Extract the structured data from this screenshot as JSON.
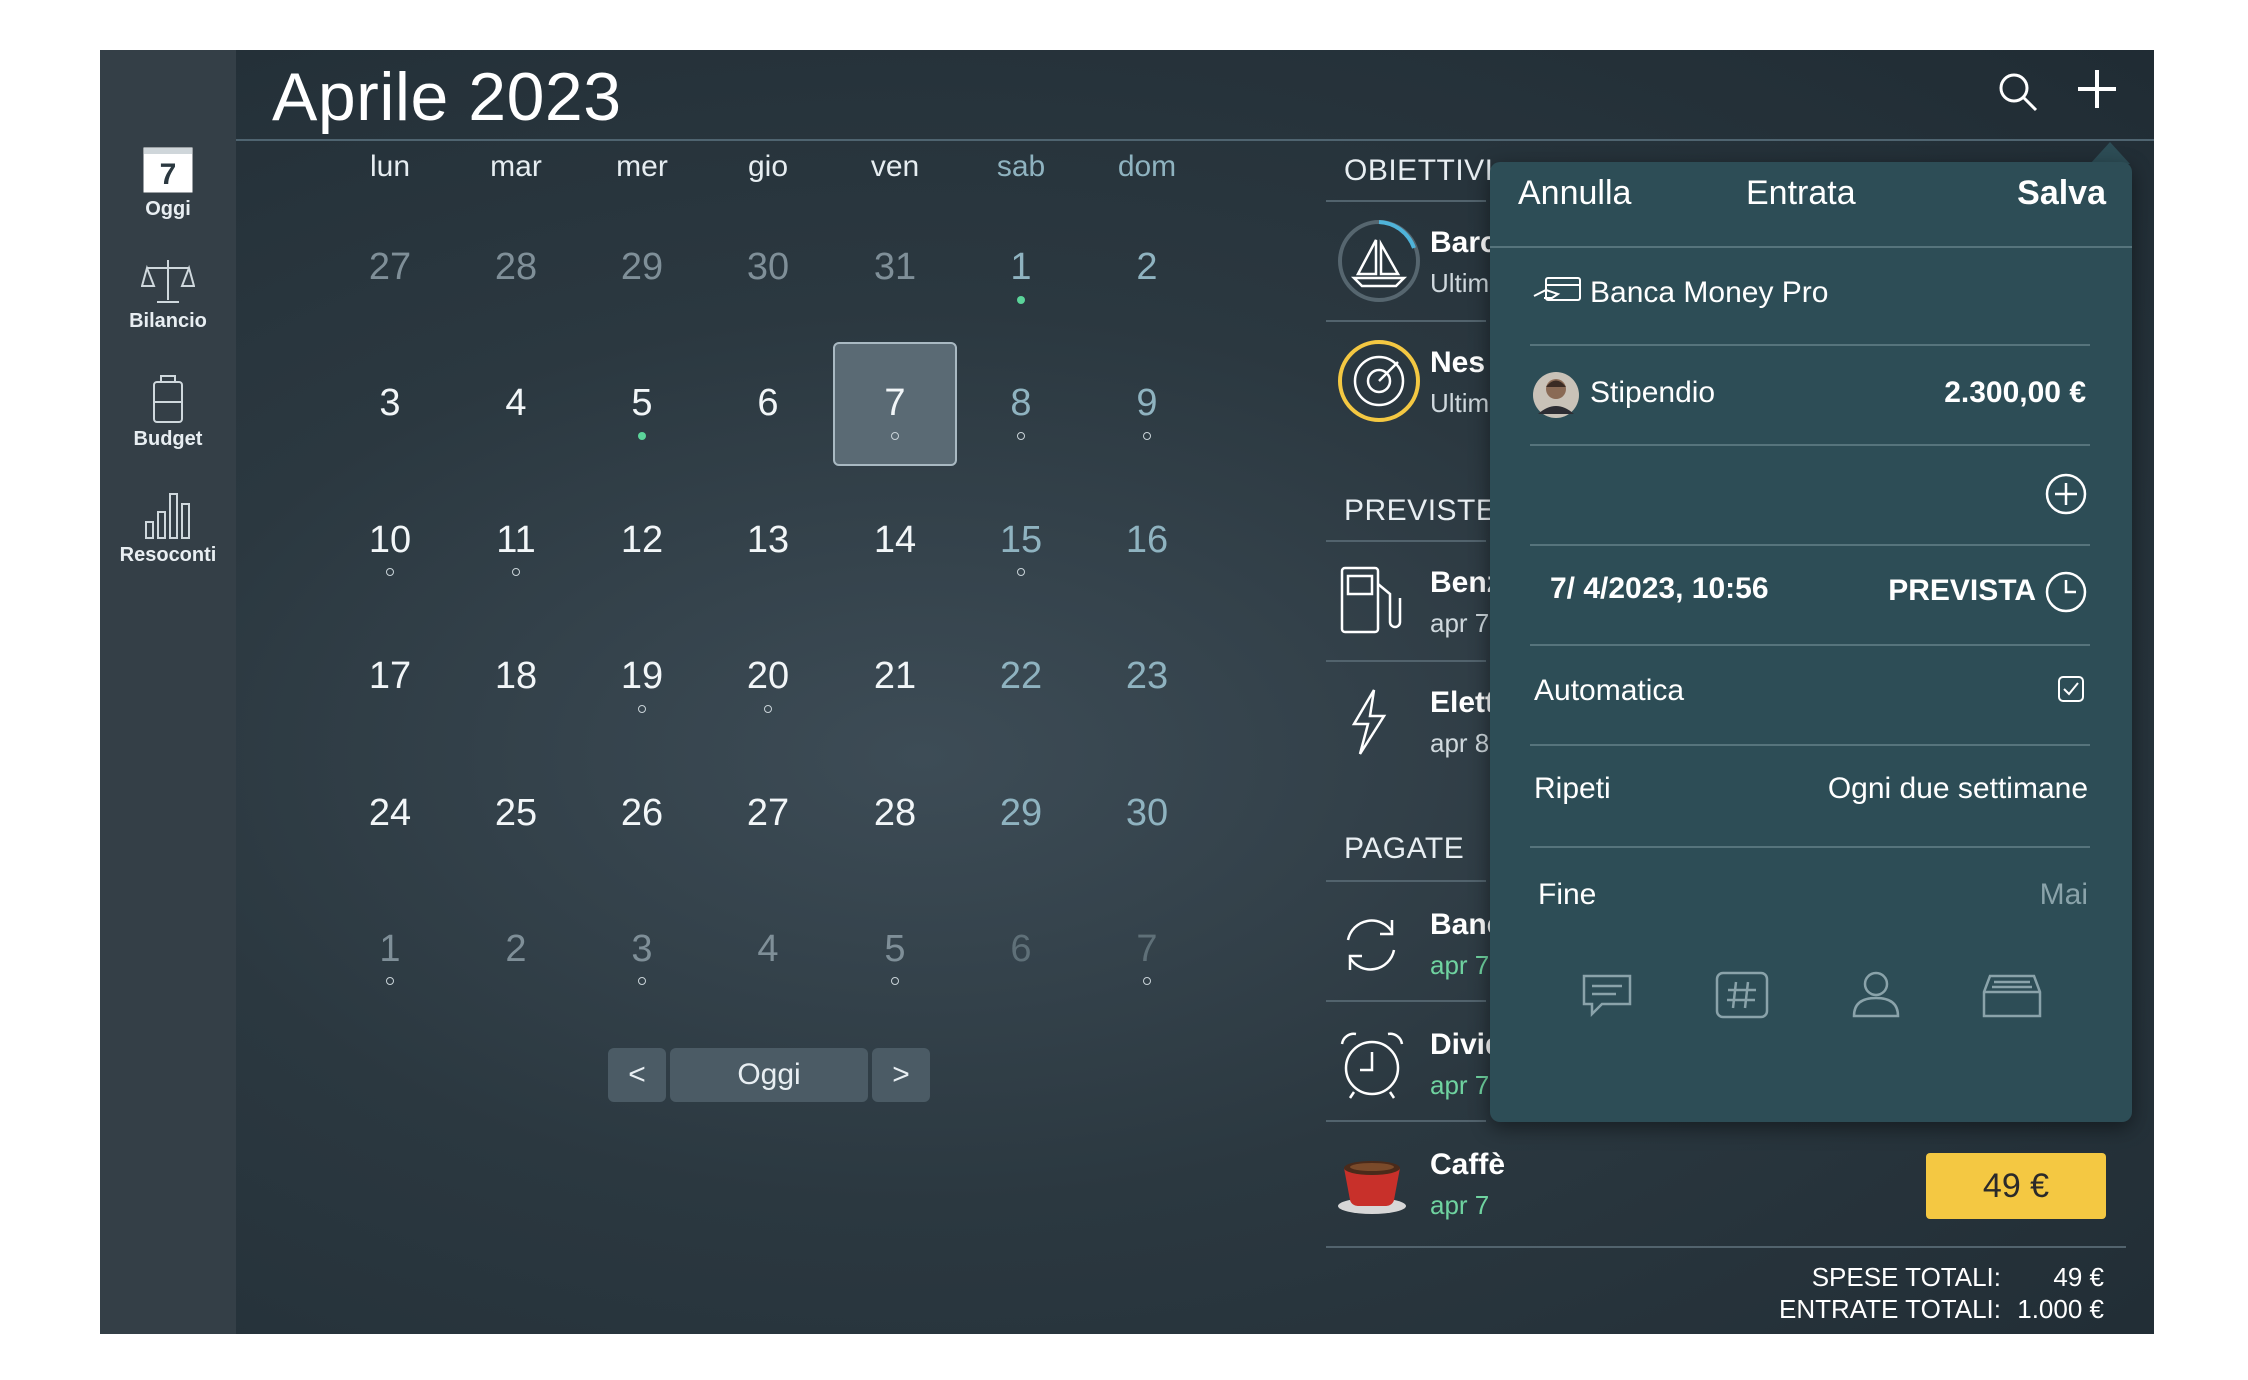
{
  "header": {
    "title": "Aprile 2023"
  },
  "sidebar": {
    "items": [
      {
        "label": "Oggi",
        "day": "7"
      },
      {
        "label": "Bilancio"
      },
      {
        "label": "Budget"
      },
      {
        "label": "Resoconti"
      }
    ]
  },
  "calendar": {
    "weekdays": [
      "lun",
      "mar",
      "mer",
      "gio",
      "ven",
      "sab",
      "dom"
    ],
    "weeks": [
      [
        "27",
        "28",
        "29",
        "30",
        "31",
        "1",
        "2"
      ],
      [
        "3",
        "4",
        "5",
        "6",
        "7",
        "8",
        "9"
      ],
      [
        "10",
        "11",
        "12",
        "13",
        "14",
        "15",
        "16"
      ],
      [
        "17",
        "18",
        "19",
        "20",
        "21",
        "22",
        "23"
      ],
      [
        "24",
        "25",
        "26",
        "27",
        "28",
        "29",
        "30"
      ],
      [
        "1",
        "2",
        "3",
        "4",
        "5",
        "6",
        "7"
      ]
    ],
    "nav": {
      "prev": "<",
      "today": "Oggi",
      "next": ">"
    }
  },
  "list": {
    "obiettivi_title": "OBIETTIVI",
    "previste_title": "PREVISTE",
    "pagate_title": "PAGATE",
    "goals": [
      {
        "title": "Barc",
        "sub": "Ultim"
      },
      {
        "title": "Nes",
        "sub": "Ultim"
      }
    ],
    "planned": [
      {
        "title": "Benz",
        "sub": "apr 7"
      },
      {
        "title": "Elett",
        "sub": "apr 8"
      }
    ],
    "paid": [
      {
        "title": "Banc",
        "sub": "apr 7"
      },
      {
        "title": "Divid",
        "sub": "apr 7"
      },
      {
        "title": "Caffè",
        "sub": "apr 7",
        "amount": "49 €"
      }
    ],
    "totals": {
      "expenses_label": "SPESE TOTALI:",
      "expenses_value": "49 €",
      "income_label": "ENTRATE TOTALI:",
      "income_value": "1.000 €"
    },
    "partial_top": "ı ı"
  },
  "popup": {
    "cancel": "Annulla",
    "type": "Entrata",
    "save": "Salva",
    "account": "Banca Money Pro",
    "category": "Stipendio",
    "amount": "2.300,00 €",
    "date": "7/  4/2023, 10:56",
    "status": "PREVISTA",
    "automatic_label": "Automatica",
    "repeat_label": "Ripeti",
    "repeat_value": "Ogni due settimane",
    "end_label": "Fine",
    "end_value": "Mai"
  },
  "colors": {
    "accent_yellow": "#f4c842",
    "popup_bg": "#2d4d56",
    "green_dot": "#5bd49a"
  }
}
